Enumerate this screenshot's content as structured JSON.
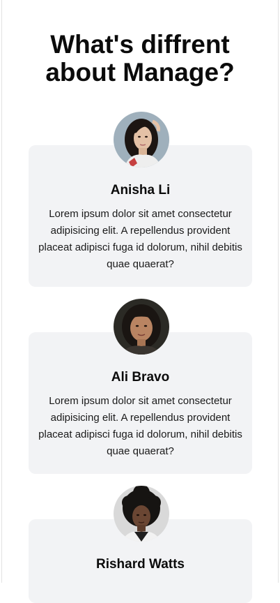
{
  "section": {
    "title_line1": "What's diffrent",
    "title_line2": "about Manage?"
  },
  "testimonials": [
    {
      "name": "Anisha Li",
      "text": "Lorem ipsum dolor sit amet consectetur adipisicing elit. A repellendus provident placeat adipisci fuga id dolorum, nihil debitis quae quaerat?",
      "avatar_icon": "woman-portrait-photo"
    },
    {
      "name": "Ali Bravo",
      "text": "Lorem ipsum dolor sit amet consectetur adipisicing elit. A repellendus provident placeat adipisci fuga id dolorum, nihil debitis quae quaerat?",
      "avatar_icon": "woman-portrait-photo"
    },
    {
      "name": "Rishard Watts",
      "text": "",
      "avatar_icon": "person-portrait-photo"
    }
  ],
  "colors": {
    "card_background": "#f2f3f5",
    "heading": "#0b0b0b"
  }
}
